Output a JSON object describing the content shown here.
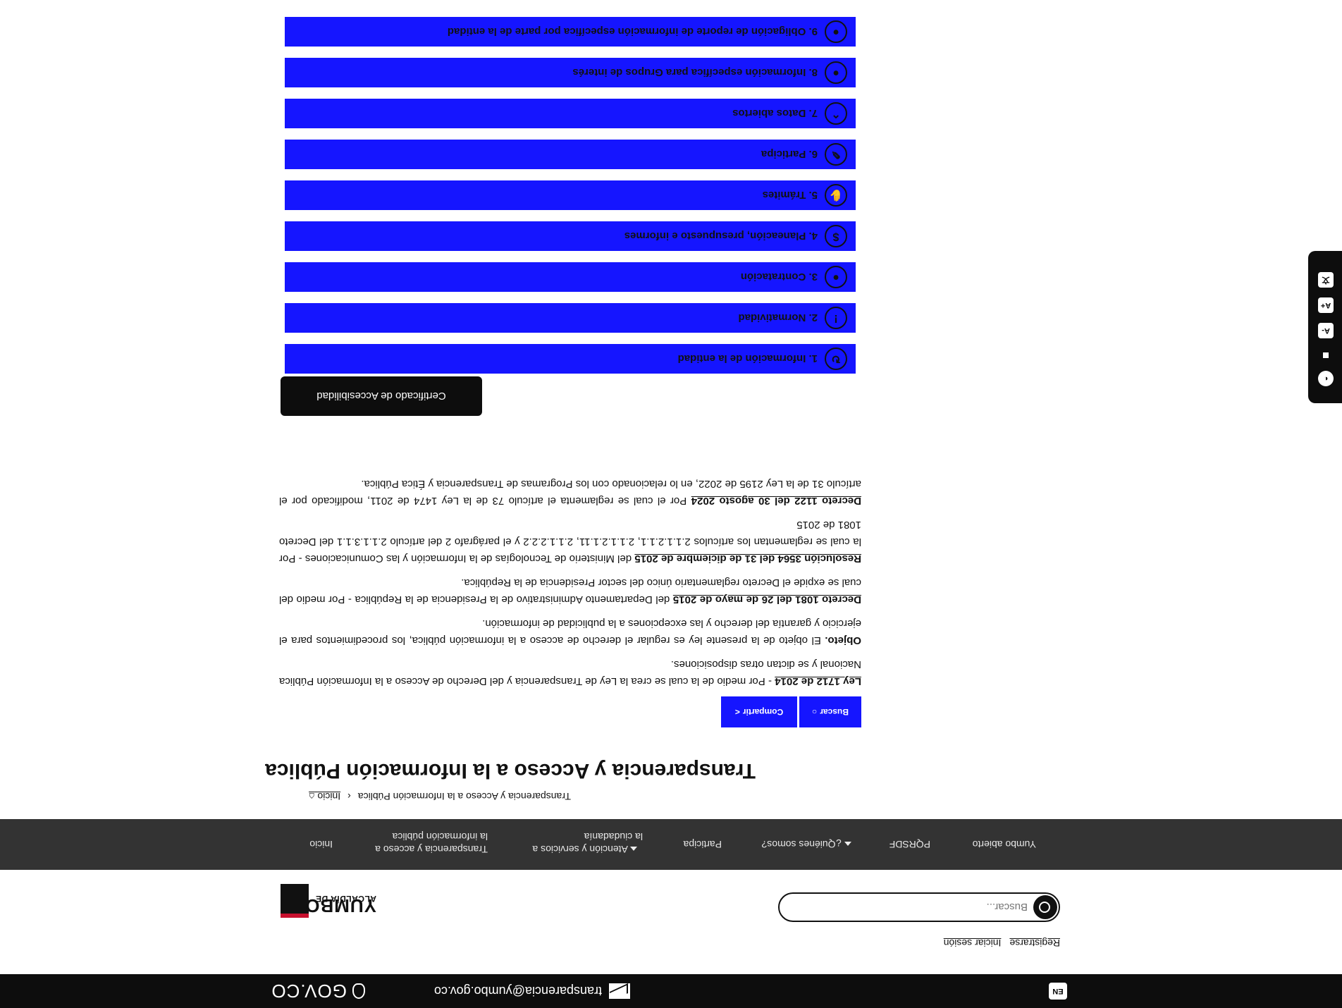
{
  "gov_bar": {
    "logo_text": "GOV.CO",
    "email": "transparencia@yumbo.gov.co",
    "language_button": "EN"
  },
  "header": {
    "logo_line1": "ALCALDÍA DE",
    "logo_line2": "YUMBO",
    "search_placeholder": "Buscar...",
    "login": "Iniciar sesión",
    "register": "Registrarse"
  },
  "nav": {
    "items": [
      "Inicio",
      "Transparencia y acceso a la información pública",
      "Atención y servicios a la ciudadanía",
      "Participa",
      "¿Quiénes somos?",
      "PQRSDF",
      "Yumbo abierto"
    ]
  },
  "breadcrumb": {
    "home": "Inicio",
    "current": "Transparencia y Acceso a la Información Pública"
  },
  "page": {
    "title": "Transparencia y Acceso a la Información Pública",
    "search_button": "Buscar",
    "share_button": "Compartir"
  },
  "content": {
    "p1_strong": "Ley 1712 de 2014",
    "p1_text": " - Por medio de la cual se crea la Ley de Transparencia y del Derecho de Acceso a la Información Pública Nacional y se dictan otras disposiciones.",
    "p2_strong": "Objeto.",
    "p2_text": " El objeto de la presente ley es regular el derecho de acceso a la información pública, los procedimientos para el ejercicio y garantía del derecho y las excepciones a la publicidad de información.",
    "p3_strong": "Decreto 1081 del 26 de mayo de 2015",
    "p3_text": " del Departamento Administrativo de la Presidencia de la República - Por medio del cual se expide el Decreto reglamentario único del sector Presidencia de la República.",
    "p4_strong": "Resolución  3564 del 31 de diciembre de 2015",
    "p4_text": " del Ministerio de Tecnologías de la Información y las Comunicaciones - Por la cual se reglamentan los artículos 2.1.1.2.1.1, 2.1.1.2.1.11, 2.1.1.2.2.2 y el parágrafo 2 del artículo 2.1.1.3.1.1 del Decreto 1081 de 2015",
    "p5_strong": "Decreto 1122 del  30 agosto 2024",
    "p5_text": " Por el cual se reglamenta el artículo 73 de la Ley 1474 de 2011, modificado por el artículo 31 de la Ley 2195 de 2022, en lo relacionado con los Programas de Transparencia y Ética Pública.",
    "certificate_button": "Certificado de Accesibilidad"
  },
  "accordion": [
    {
      "label": "1. Información de la entidad",
      "icon": "cycle-icon",
      "glyph": "↻"
    },
    {
      "label": "2. Normatividad",
      "icon": "info-icon",
      "glyph": "!"
    },
    {
      "label": "3. Contratación",
      "icon": "stamp-icon",
      "glyph": "●"
    },
    {
      "label": "4. Planeación, presupuesto e informes",
      "icon": "dollar-icon",
      "glyph": "$"
    },
    {
      "label": "5. Trámites",
      "icon": "hand-icon",
      "glyph": "✋"
    },
    {
      "label": "6. Participa",
      "icon": "pencil-icon",
      "glyph": "✎"
    },
    {
      "label": "7. Datos abiertos",
      "icon": "chart-icon",
      "glyph": "⌃"
    },
    {
      "label": "8. Información específica para Grupos de interés",
      "icon": "stamp-icon",
      "glyph": "●"
    },
    {
      "label": "9. Obligación de reporte de información específica por parte de la entidad",
      "icon": "stamp-icon",
      "glyph": "●"
    }
  ],
  "accessibility_toolbar": {
    "buttons": [
      "contrast-icon",
      "arrow-icon",
      "font-decrease-icon",
      "font-increase-icon",
      "translate-icon"
    ]
  }
}
